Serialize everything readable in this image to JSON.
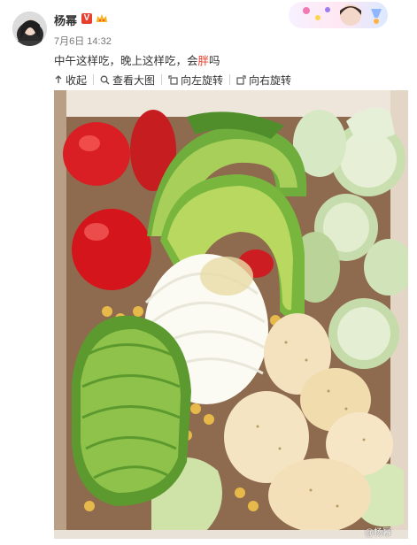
{
  "post": {
    "author": "杨幂",
    "time": "7月6日 14:32",
    "text_before": "中午这样吃，晚上这样吃，会",
    "text_highlight": "胖",
    "text_after": "吗",
    "vip_badge": "V"
  },
  "toolbar": {
    "collapse_label": "收起",
    "view_large_label": "查看大图",
    "rotate_left_label": "向左旋转",
    "rotate_right_label": "向右旋转"
  },
  "photo": {
    "watermark": "@杨幂",
    "subject": "salad box"
  },
  "icons": {
    "collapse": "arrow-up-icon",
    "view_large": "magnifier-icon",
    "rotate_left": "rotate-left-icon",
    "rotate_right": "rotate-right-icon",
    "crown": "crown-icon"
  },
  "colors": {
    "highlight": "#e8402f",
    "text": "#333333",
    "meta": "#777777"
  }
}
